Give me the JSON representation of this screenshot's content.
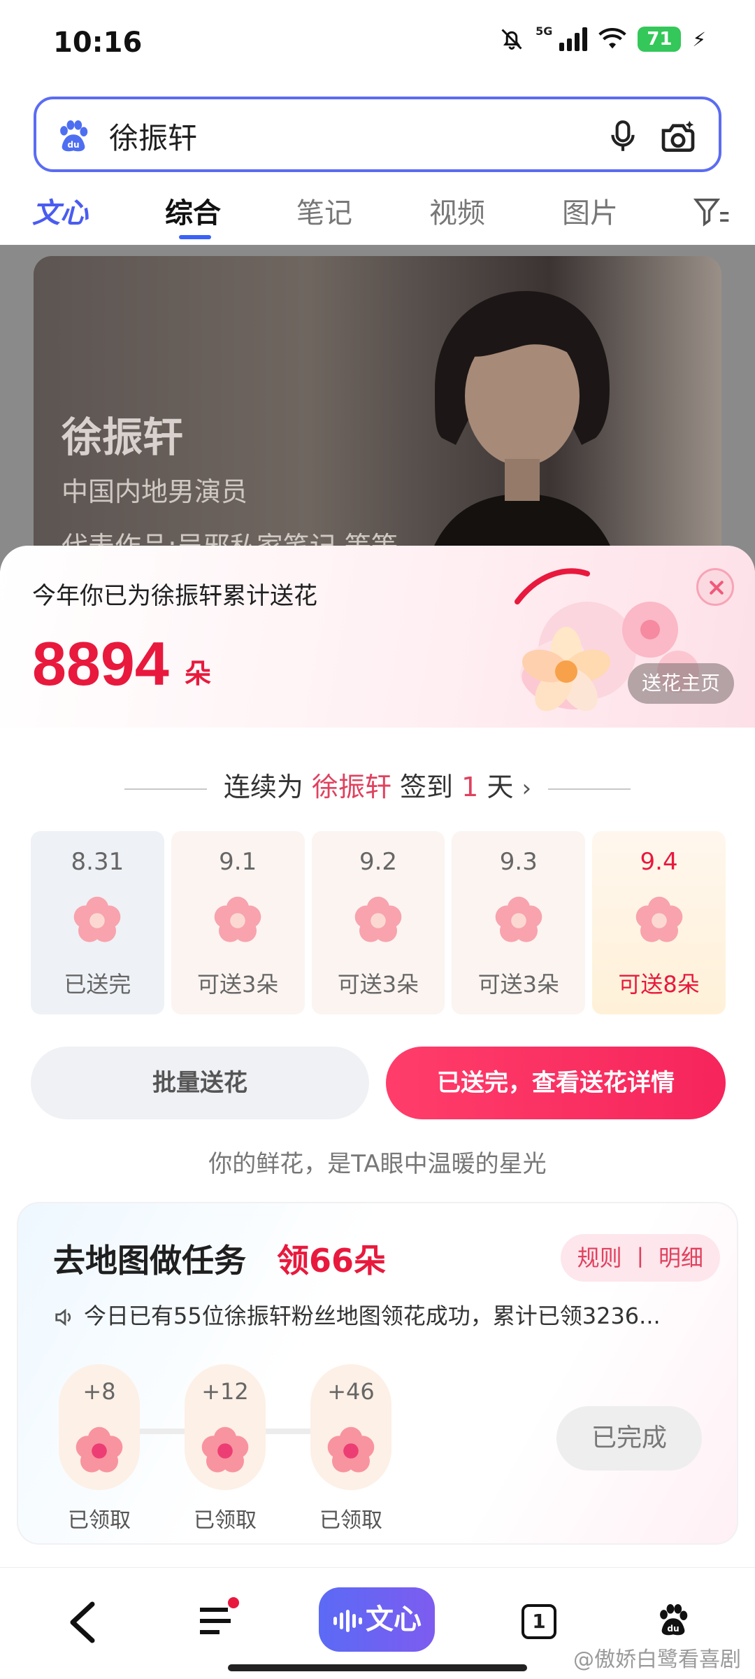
{
  "status_bar": {
    "time": "10:16",
    "network": "5G",
    "battery": "71"
  },
  "search": {
    "query": "徐振轩"
  },
  "tabs": [
    {
      "label": "文心"
    },
    {
      "label": "综合"
    },
    {
      "label": "笔记"
    },
    {
      "label": "视频"
    },
    {
      "label": "图片"
    }
  ],
  "hero": {
    "name": "徐振轩",
    "subtitle": "中国内地男演员",
    "works": "代表作品:吴邪私家笔记 等等"
  },
  "panel": {
    "title": "今年你已为徐振轩累计送花",
    "count": "8894",
    "unit": "朵",
    "home_button": "送花主页",
    "streak": {
      "prefix": "连续为",
      "name": "徐振轩",
      "mid": "签到",
      "days": "1",
      "suffix": "天",
      "arrow": "›"
    },
    "days": [
      {
        "date": "8.31",
        "label": "已送完"
      },
      {
        "date": "9.1",
        "label": "可送3朵"
      },
      {
        "date": "9.2",
        "label": "可送3朵"
      },
      {
        "date": "9.3",
        "label": "可送3朵"
      },
      {
        "date": "9.4",
        "label": "可送8朵"
      }
    ],
    "batch_button": "批量送花",
    "details_button": "已送完，查看送花详情",
    "slogan": "你的鲜花，是TA眼中温暖的星光"
  },
  "task": {
    "title": "去地图做任务",
    "title_highlight": "领66朵",
    "rules": "规则 丨 明细",
    "notice": "今日已有55位徐振轩粉丝地图领花成功，累计已领3236...",
    "steps": [
      {
        "points": "+8",
        "status": "已领取"
      },
      {
        "points": "+12",
        "status": "已领取"
      },
      {
        "points": "+46",
        "status": "已领取"
      }
    ],
    "completed": "已完成"
  },
  "bottom_nav": {
    "wenxin_label": "文心",
    "tab_count": "1",
    "watermark": "@傲娇白鹭看喜剧"
  },
  "colors": {
    "accent": "#e8193d",
    "brand": "#4a5cf0"
  }
}
